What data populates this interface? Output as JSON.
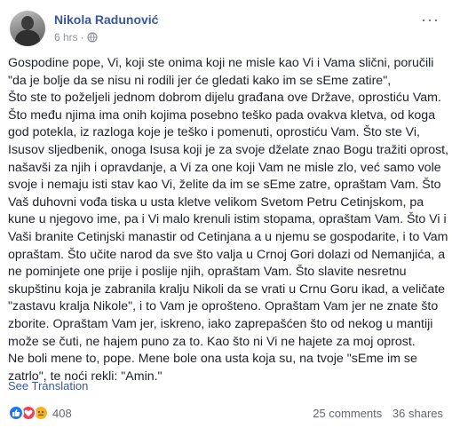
{
  "post": {
    "author": "Nikola Radunović",
    "time": "6 hrs",
    "separator": "·",
    "more_label": "···",
    "lines": [
      "Gospodine pope, Vi, koji ste onima koji ne misle kao Vi i Vama slični, poručili",
      "\"da je bolje da se nisu ni rodili jer će gledati kako im se sEme zatire\",",
      "Što ste to poželjeli jednom dobrom dijelu građana ove Države, oprostiću Vam.",
      "Što među njima ima onih kojima posebno teško pada ovakva kletva, od koga",
      "god potekla, iz razloga koje je teško i pomenuti, oprostiću Vam. Što ste Vi,",
      "Isusov sljedbenik, onoga Isusa koji je za svoje dželate znao Bogu tražiti oprost,",
      "našavši za njih i opravdanje, a Vi za one koji Vam ne misle zlo, već samo vole",
      "svoje i nemaju isti stav kao Vi, želite da im se sEme zatre, opraštam Vam. Što",
      "Vaš duhovni vođa tiska u usta kletve velikom Svetom Petru Cetinjskom, pa",
      "kune u njegovo ime, pa i Vi malo krenuli istim stopama, opraštam Vam. Što Vi i",
      "Vaši branite Cetinjski manastir od Cetinjana a u njemu se gospodarite, i to Vam",
      "opraštam. Što učite narod da sve što valja u Crnoj Gori dolazi od Nemanjića, a",
      "ne pominjete one prije i poslije njih, opraštam Vam. Što slavite nesretnu",
      "skupštinu koja je zabranila kralju Nikoli da se vrati u Crnu Goru ikad, a veličate",
      "\"zastavu kralja Nikole\", i to Vam je oprošteno. Opraštam Vam jer ne znate što",
      "zborite. Opraštam Vam jer, iskreno, iako zaprepašćen što od nekog u mantiji",
      "može se čuti, ne hajem puno za to. Kao što ni Vi ne hajete za moj oprost.",
      "Ne boli mene to, pope. Mene bole ona usta koja su, na tvoje \"sEme im se",
      "zatrlo\", te noći rekli: \"Amin.\""
    ],
    "see_translation": "See Translation"
  },
  "footer": {
    "reactions": [
      "like-icon",
      "love-icon",
      "sad-icon"
    ],
    "reaction_count": "408",
    "comments": "25 comments",
    "shares": "36 shares"
  },
  "colors": {
    "link": "#385898",
    "text": "#1d2129",
    "muted": "#90949c",
    "like": "#1877f2",
    "love": "#f33e58",
    "sad": "#f7b125"
  }
}
